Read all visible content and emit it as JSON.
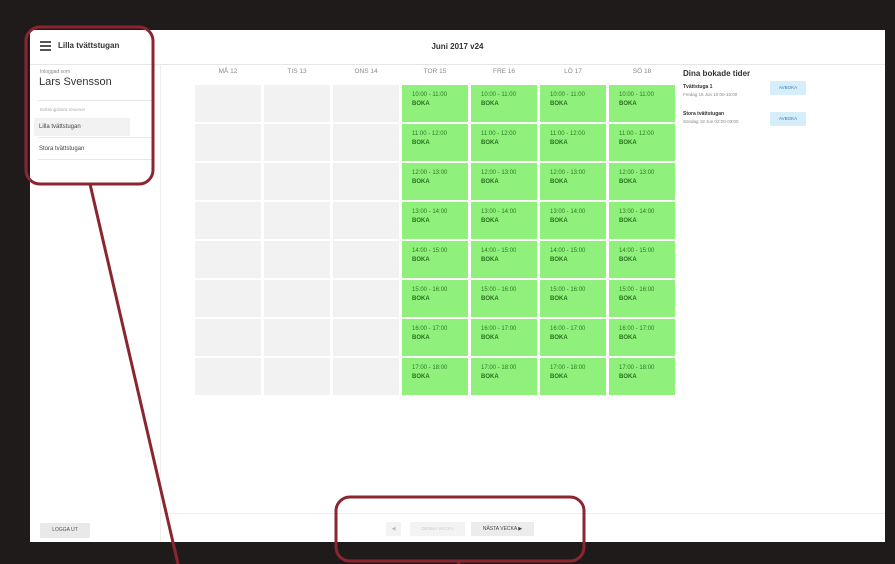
{
  "app": {
    "title": "Lilla tvättstugan",
    "week_title": "Juni 2017 v24"
  },
  "sidebar": {
    "logged_label": "Inloggad som",
    "user_name": "Lars Svensson",
    "section_label": "Bokningsbara resurser",
    "items": [
      {
        "label": "Lilla tvättstugan",
        "active": true
      },
      {
        "label": "Stora tvättstugan",
        "active": false
      }
    ],
    "logout_label": "LOGGA UT"
  },
  "calendar": {
    "days": [
      "MÅ 12",
      "TIS 13",
      "ONS 14",
      "TOR 15",
      "FRE 16",
      "LÖ 17",
      "SÖ 18"
    ],
    "available_from_day_index": 3,
    "time_slots": [
      "10:00 - 11:00",
      "11:00 - 12:00",
      "12:00 - 13:00",
      "13:00 - 14:00",
      "14:00 - 15:00",
      "15:00 - 16:00",
      "16:00 - 17:00",
      "17:00 - 18:00"
    ],
    "book_label": "BOKA",
    "colors": {
      "available": "#8ff07c",
      "unavailable": "#f2f2f2"
    }
  },
  "booked": {
    "title": "Dina bokade tider",
    "items": [
      {
        "name": "Tvättstuga 1",
        "time": "Fredag 16 Jun 10:00-15:00",
        "cancel_label": "AVBOKA"
      },
      {
        "name": "Stora tvättstugan",
        "time": "Söndag 18 Jun 02:00-03:00",
        "cancel_label": "AVBOKA"
      }
    ]
  },
  "pagination": {
    "prev_label": "◀",
    "this_week_label": "DENNA VECKA",
    "next_label": "NÄSTA VECKA ▶"
  },
  "annotation_color": "#8b2630"
}
